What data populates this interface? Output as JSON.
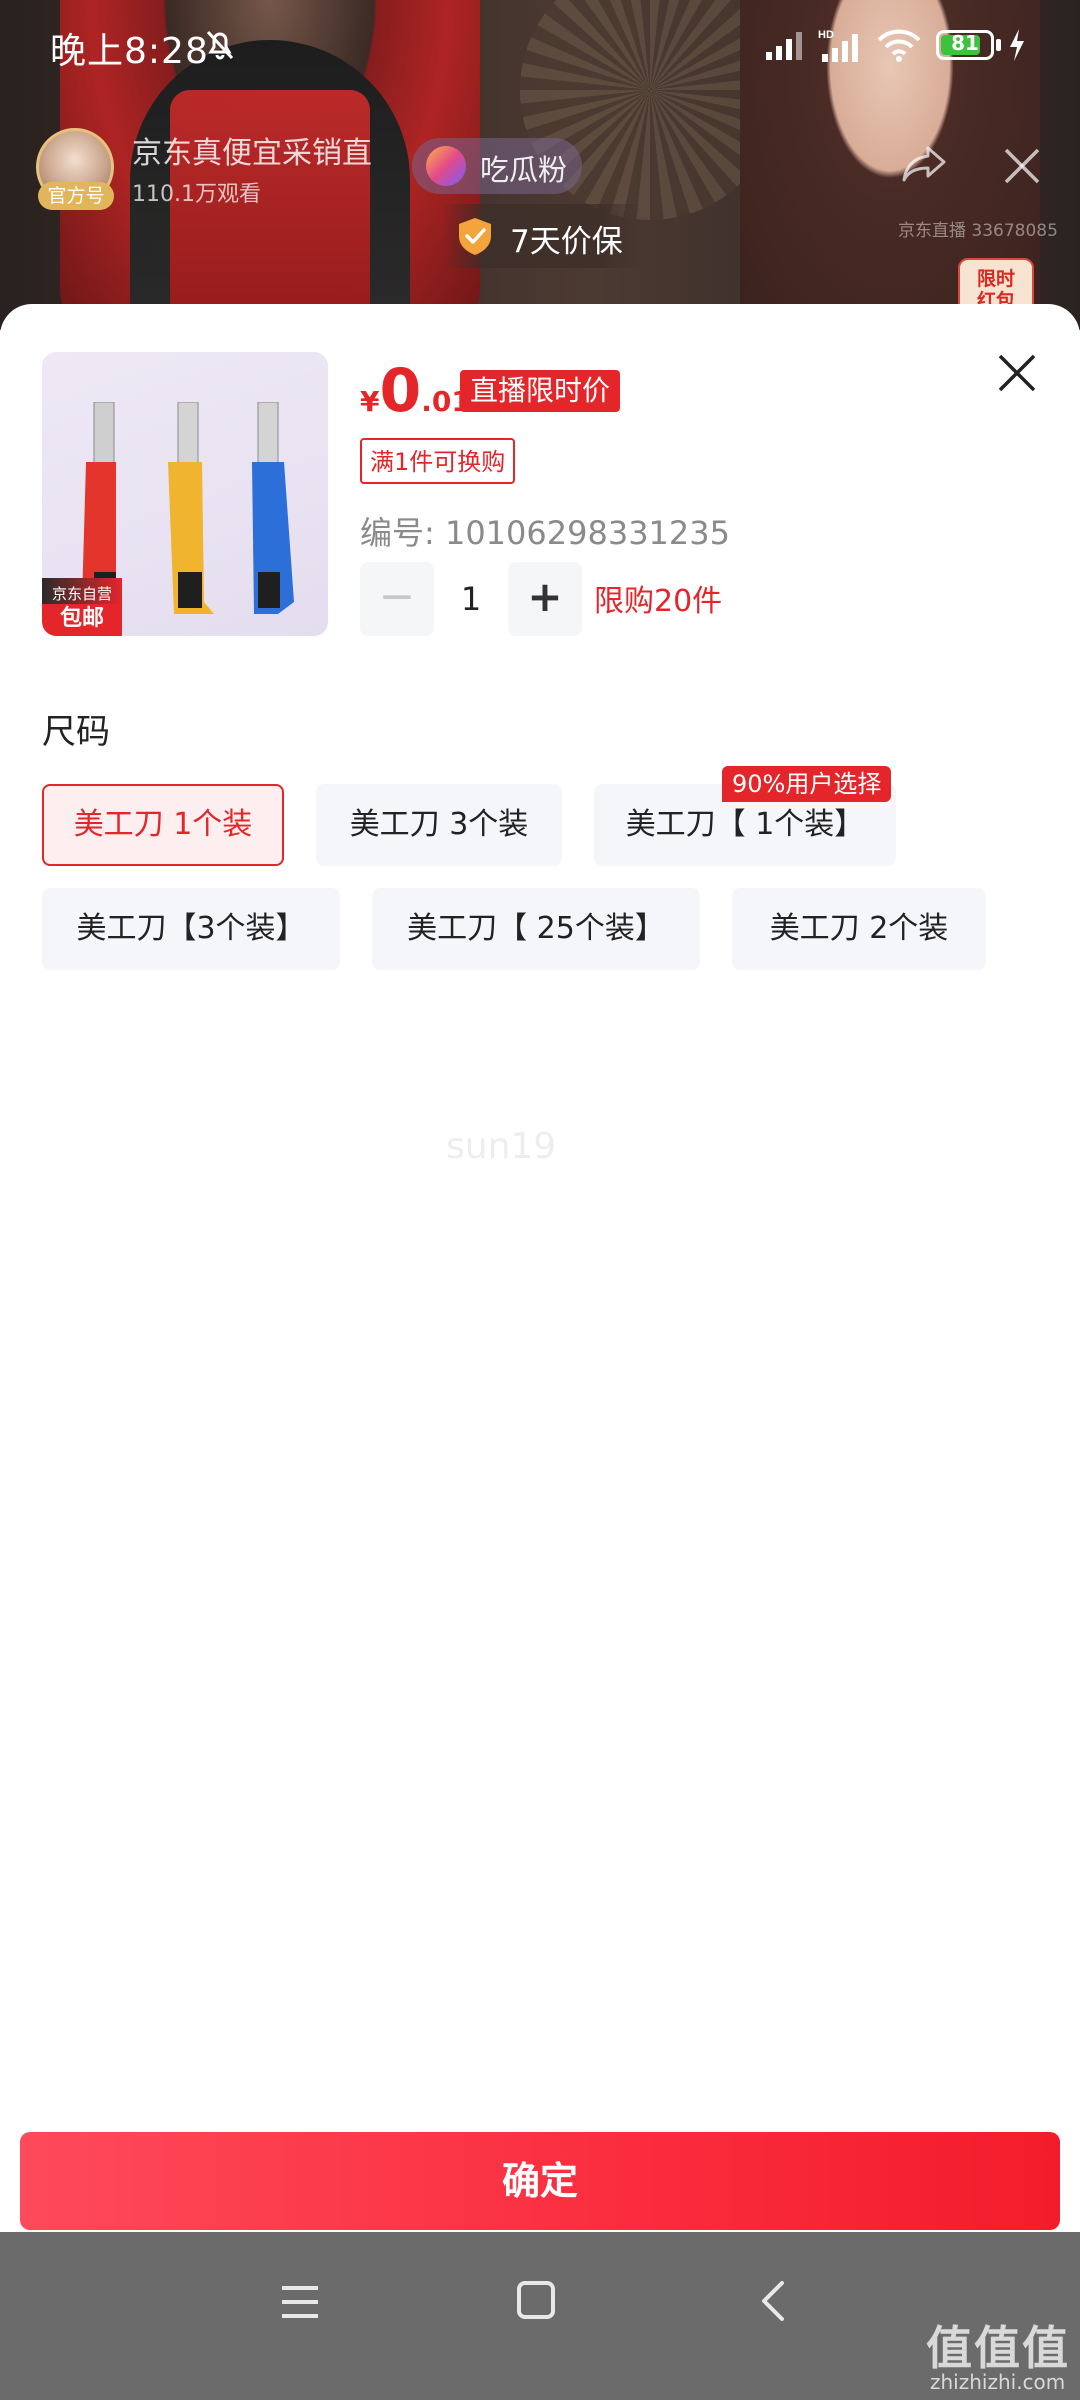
{
  "status_bar": {
    "time": "晚上8:28",
    "battery": "81",
    "battery_level_percent": 81,
    "icons": [
      "bell-off-icon",
      "signal-icon",
      "hd-signal-icon",
      "wifi-icon",
      "battery-icon",
      "charging-icon"
    ]
  },
  "stream": {
    "anchor_name": "京东真便宜采销直",
    "official_badge": "官方号",
    "viewers": "110.1万观看",
    "follow_label": "吃瓜粉",
    "price_guarantee": "7天价保",
    "room_id": "京东直播 33678085",
    "redpack_label": "限时\n红包"
  },
  "product": {
    "price_currency": "¥",
    "price_integer": "0",
    "price_decimal": ".01",
    "live_price_tag": "直播限时价",
    "swap_tag": "满1件可换购",
    "sku_code": "编号: 10106298331235",
    "quantity": "1",
    "minus_label": "−",
    "plus_label": "+",
    "limit_text": "限购20件",
    "thumb_badge_top": "京东自营",
    "thumb_badge_bottom": "包邮"
  },
  "size_section": {
    "title": "尺码",
    "options": [
      {
        "label": "美工刀 1个装",
        "selected": true
      },
      {
        "label": "美工刀 3个装",
        "selected": false
      },
      {
        "label": "美工刀【 1个装】",
        "selected": false
      },
      {
        "label": "美工刀【3个装】",
        "selected": false
      },
      {
        "label": "美工刀【 25个装】",
        "selected": false
      },
      {
        "label": "美工刀  2个装",
        "selected": false
      }
    ],
    "popular_badge": "90%用户选择"
  },
  "watermark": "sun19",
  "confirm_label": "确定",
  "site": {
    "logo": "值值值",
    "url": "zhizhizhi.com"
  },
  "colors": {
    "accent_red": "#e4262b",
    "option_bg": "#f5f6fa",
    "navbar_bg": "#6b6b6b"
  }
}
